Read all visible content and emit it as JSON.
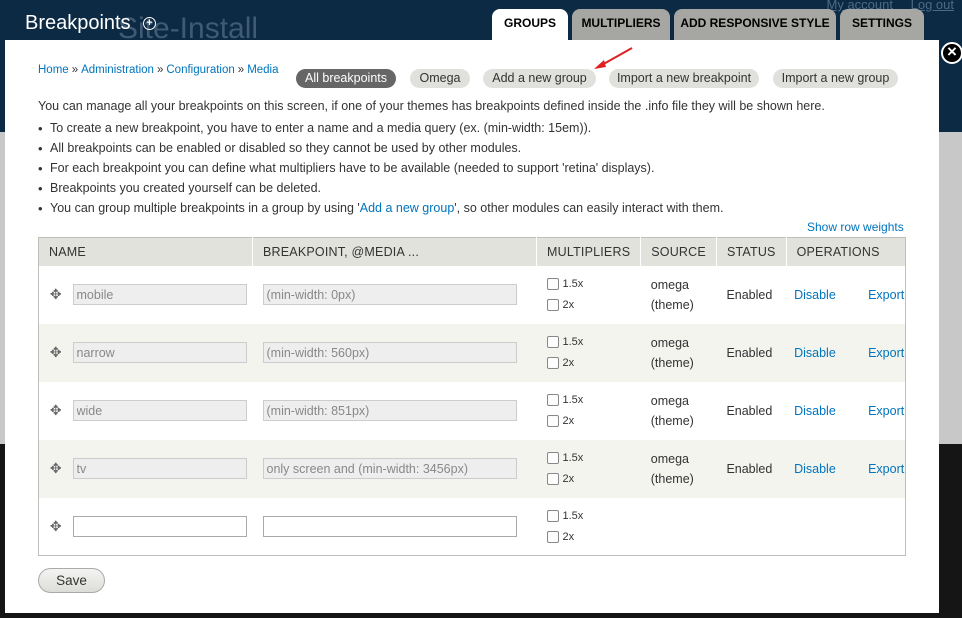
{
  "background": {
    "site_name": "Site-Install",
    "links": [
      "My account",
      "Log out"
    ]
  },
  "overlay": {
    "title": "Breakpoints",
    "shortcut_icon": "add-shortcut-icon",
    "tabs": [
      {
        "label": "GROUPS",
        "active": true
      },
      {
        "label": "MULTIPLIERS",
        "active": false
      },
      {
        "label": "ADD RESPONSIVE STYLE",
        "active": false
      },
      {
        "label": "SETTINGS",
        "active": false
      }
    ],
    "close_icon": "close-icon"
  },
  "breadcrumb": [
    "Home",
    "Administration",
    "Configuration",
    "Media"
  ],
  "breadcrumb_separator": "»",
  "actions": [
    {
      "label": "All breakpoints",
      "active": true
    },
    {
      "label": "Omega",
      "active": false
    },
    {
      "label": "Add a new group",
      "active": false
    },
    {
      "label": "Import a new breakpoint",
      "active": false
    },
    {
      "label": "Import a new group",
      "active": false
    }
  ],
  "help": {
    "intro": "You can manage all your breakpoints on this screen, if one of your themes has breakpoints defined inside the .info file they will be shown here.",
    "items": [
      "To create a new breakpoint, you have to enter a name and a media query (ex. (min-width: 15em)).",
      "All breakpoints can be enabled or disabled so they cannot be used by other modules.",
      "For each breakpoint you can define what multipliers have to be available (needed to support 'retina' displays).",
      "Breakpoints you created yourself can be deleted."
    ],
    "last_item_prefix": "You can group multiple breakpoints in a group by using '",
    "last_item_link": "Add a new group",
    "last_item_suffix": "', so other modules can easily interact with them."
  },
  "row_weights_label": "Show row weights",
  "table": {
    "headers": [
      "NAME",
      "BREAKPOINT, @MEDIA ...",
      "MULTIPLIERS",
      "SOURCE",
      "STATUS",
      "OPERATIONS"
    ],
    "multiplier_options": [
      "1.5x",
      "2x"
    ],
    "rows": [
      {
        "name": "mobile",
        "query": "(min-width: 0px)",
        "source_line1": "omega",
        "source_line2": "(theme)",
        "status": "Enabled",
        "op1": "Disable",
        "op2": "Export"
      },
      {
        "name": "narrow",
        "query": "(min-width: 560px)",
        "source_line1": "omega",
        "source_line2": "(theme)",
        "status": "Enabled",
        "op1": "Disable",
        "op2": "Export"
      },
      {
        "name": "wide",
        "query": "(min-width: 851px)",
        "source_line1": "omega",
        "source_line2": "(theme)",
        "status": "Enabled",
        "op1": "Disable",
        "op2": "Export"
      },
      {
        "name": "tv",
        "query": "only screen and (min-width: 3456px)",
        "source_line1": "omega",
        "source_line2": "(theme)",
        "status": "Enabled",
        "op1": "Disable",
        "op2": "Export"
      }
    ]
  },
  "save_label": "Save",
  "colors": {
    "link": "#0074bd",
    "annotation_arrow": "#e02020",
    "topbar": "#0d2a44"
  }
}
